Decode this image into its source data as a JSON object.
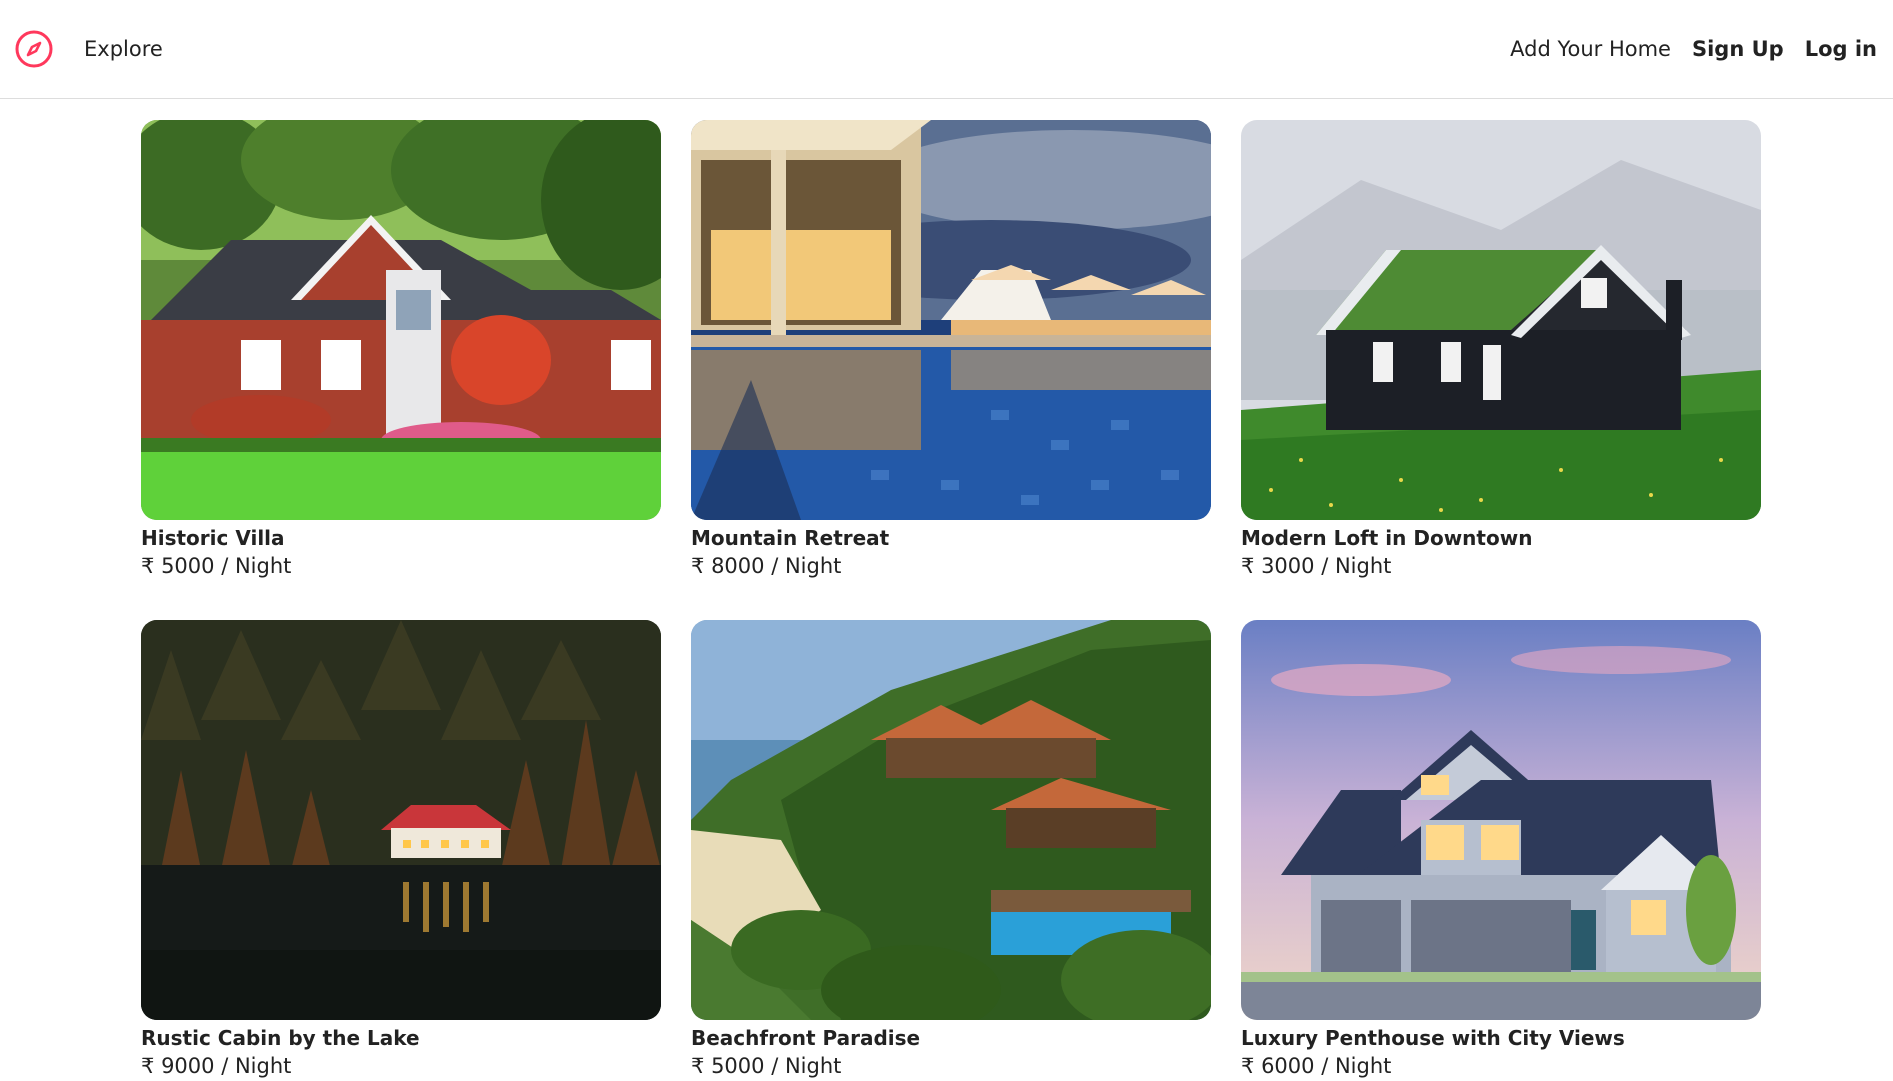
{
  "nav": {
    "logo_icon": "compass-icon",
    "brand_color": "#ff385c",
    "explore_label": "Explore",
    "add_home_label": "Add Your Home",
    "signup_label": "Sign Up",
    "login_label": "Log in"
  },
  "listings": [
    {
      "title": "Historic Villa",
      "currency": "₹",
      "price": "5000",
      "unit": "/ Night"
    },
    {
      "title": "Mountain Retreat",
      "currency": "₹",
      "price": "8000",
      "unit": "/ Night"
    },
    {
      "title": "Modern Loft in Downtown",
      "currency": "₹",
      "price": "3000",
      "unit": "/ Night"
    },
    {
      "title": "Rustic Cabin by the Lake",
      "currency": "₹",
      "price": "9000",
      "unit": "/ Night"
    },
    {
      "title": "Beachfront Paradise",
      "currency": "₹",
      "price": "5000",
      "unit": "/ Night"
    },
    {
      "title": "Luxury Penthouse with City Views",
      "currency": "₹",
      "price": "6000",
      "unit": "/ Night"
    }
  ]
}
